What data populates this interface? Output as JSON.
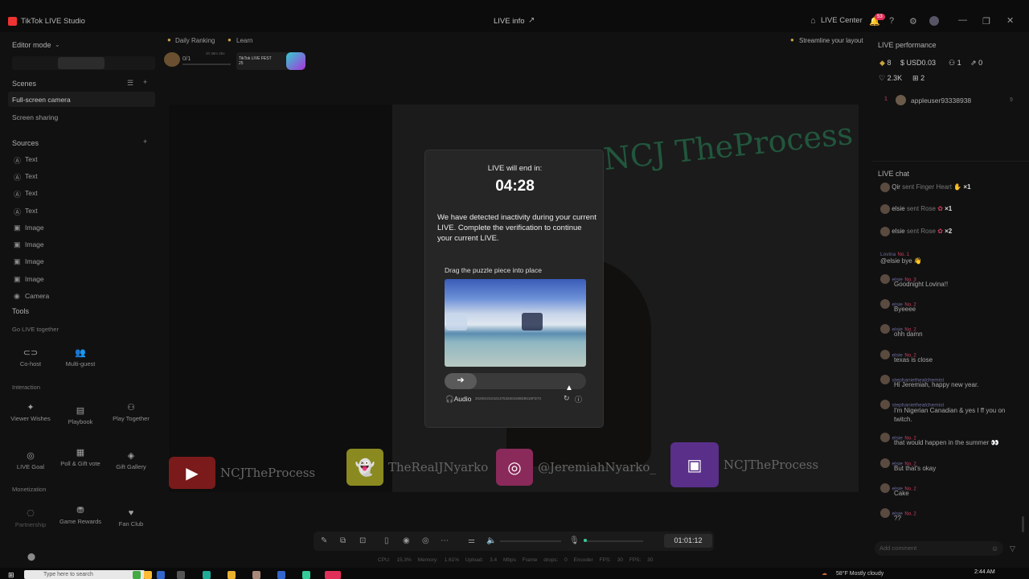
{
  "window": {
    "app_title": "TikTok LIVE Studio",
    "center_title": "LIVE info",
    "live_center": "LIVE Center",
    "notif_count": "53"
  },
  "left": {
    "editor_mode": "Editor mode",
    "scenes_header": "Scenes",
    "scenes": [
      "Full-screen camera",
      "Screen sharing"
    ],
    "sources_header": "Sources",
    "sources": [
      "Text",
      "Text",
      "Text",
      "Text",
      "Image",
      "Image",
      "Image",
      "Image",
      "Camera"
    ],
    "tools_header": "Tools",
    "go_live_together": "Go LIVE together",
    "cohost": "Co-host",
    "multiguest": "Multi-guest",
    "interaction": "Interaction",
    "viewer_wishes": "Viewer Wishes",
    "playbook": "Playbook",
    "play_together": "Play Together",
    "live_goal": "LIVE Goal",
    "poll": "Poll & Gift vote",
    "gift_gallery": "Gift Gallery",
    "monetization": "Monetization",
    "partnership": "Partnership",
    "game_rewards": "Game Rewards",
    "fan_club": "Fan Club"
  },
  "top": {
    "daily_ranking": "Daily Ranking",
    "learn": "Learn",
    "progress": "0/1",
    "timer_small": "2h 38m 35s",
    "fest": "TikTok LIVE FEST 25",
    "streamline": "Streamline your layout"
  },
  "canvas": {
    "neon": "NCJ TheProcess",
    "youtube": "NCJTheProcess",
    "snapchat": "TheRealJNyarko",
    "instagram": "@JeremiahNyarko_",
    "twitch": "NCJTheProcess"
  },
  "modal": {
    "title": "LIVE will end in:",
    "timer": "04:28",
    "body": "We have detected inactivity during your current LIVE. Complete the verification to continue your current LIVE.",
    "drag": "Drag the puzzle piece into place",
    "audio": "Audio",
    "code": "20260101042137532601588D8518FD73"
  },
  "right": {
    "perf_header": "LIVE performance",
    "diamonds": "8",
    "usd": "USD0.03",
    "viewers": "1",
    "shares": "0",
    "likes": "2.3K",
    "gifts": "2",
    "top_viewer": "appleuser93338938",
    "top_viewer_rank": "1",
    "top_viewer_score": "9",
    "chat_header": "LIVE chat",
    "gifts_list": [
      {
        "name": "Qir",
        "text": "sent Finger Heart",
        "count": "×1"
      },
      {
        "name": "elsie",
        "text": "sent Rose",
        "count": "×1"
      },
      {
        "name": "elsie",
        "text": "sent Rose",
        "count": "×2"
      }
    ],
    "messages": [
      {
        "name": "Lovina",
        "badge": "No. 1",
        "msg": "@elsie  bye 👋"
      },
      {
        "name": "elsie",
        "badge": "No. 3",
        "msg": "Goodnight Lovina!!"
      },
      {
        "name": "elsie",
        "badge": "No. 2",
        "msg": "Byeeee"
      },
      {
        "name": "elsie",
        "badge": "No. 2",
        "msg": "ohh damn"
      },
      {
        "name": "elsie",
        "badge": "No. 2",
        "msg": "texas is close"
      },
      {
        "name": "stephaniethealchemist",
        "badge": "",
        "msg": "Hi Jeremiah, happy new year."
      },
      {
        "name": "stephaniethealchemist",
        "badge": "",
        "msg": "I'm Nigerian Canadian & yes I ff you on twitch."
      },
      {
        "name": "elsie",
        "badge": "No. 2",
        "msg": "that would happen in the summer 👀"
      },
      {
        "name": "elsie",
        "badge": "No. 2",
        "msg": "But that's okay"
      },
      {
        "name": "elsie",
        "badge": "No. 2",
        "msg": "Cake"
      },
      {
        "name": "elsie",
        "badge": "No. 2",
        "msg": "??"
      }
    ],
    "add_comment": "Add comment"
  },
  "bottom": {
    "timer": "01:01:12",
    "stats": "CPU: 15.3%   Memory: 1.61%   Upload: 3.4 Mbps   Frame drops: 0   Encoder FPS: 30   FPS: 30"
  },
  "taskbar": {
    "search": "Type here to search",
    "weather": "58°F  Mostly cloudy",
    "time": "2:44 AM"
  }
}
